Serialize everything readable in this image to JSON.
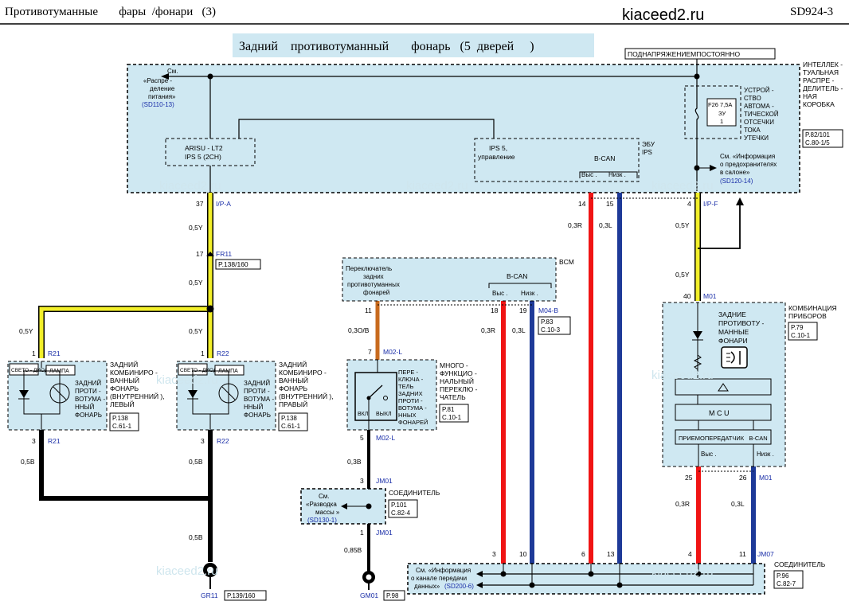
{
  "header": {
    "title_left": "Противотуманные       фары  /фонари   (3)",
    "site": "kiaceed2.ru",
    "code": "SD924-3"
  },
  "banner": {
    "title": "Задний    противотуманный       фонарь   (5  дверей     )"
  },
  "supply_label": "ПОДНАПРЯЖЕНИЕМПОСТОЯННО",
  "watermark": "kiaceed2.ru",
  "junction_box": {
    "label_lines": [
      "ИНТЕЛЛЕК -",
      "ТУАЛЬНАЯ",
      "РАСПРЕ -",
      "ДЕЛИТЕЛЬ -",
      "НАЯ",
      "КОРОБКА"
    ],
    "ref_lines": [
      "P.82/101",
      "C.80-1/5"
    ],
    "see_power_lines": [
      "См.",
      "«Распре  -",
      "деление",
      "питания»"
    ],
    "see_power_ref": "(SD110-13)",
    "arisu_lines": [
      "ARISU - LT2",
      "IPS 5 (2CH)"
    ],
    "ips_lines": [
      "IPS  5,",
      "управление"
    ],
    "bcan_label": "B-CAN",
    "bcan_high": "Выс .",
    "bcan_low": "Низк .",
    "ecu_lines": [
      "ЭБУ",
      "IPS"
    ],
    "fuse_lines": [
      "F26 7,5A",
      "ЗУ",
      "1"
    ],
    "rcd_lines": [
      "УСТРОЙ -",
      "СТВО",
      "АВТОМА -",
      "ТИЧЕСКОЙ",
      "ОТСЕЧКИ",
      "ТОКА",
      "УТЕЧКИ"
    ],
    "see_fuse_lines": [
      "См. «Информация",
      "о предохранителях",
      "в салоне»"
    ],
    "see_fuse_ref": "(SD120-14)"
  },
  "pins": {
    "p37": "37",
    "ipa": "I/P-A",
    "p17": "17",
    "fr11": "FR11",
    "fr11_ref": "P.138/160",
    "p14": "14",
    "p15": "15",
    "p4_top": "4",
    "ipf": "I/P-F",
    "p40": "40",
    "m01_top": "M01",
    "p1_left": "1",
    "r21_top": "R21",
    "p1_right": "1",
    "r22_top": "R22",
    "p3_left": "3",
    "r21_bot": "R21",
    "p3_right": "3",
    "r22_bot": "R22",
    "p11": "11",
    "p18": "18",
    "p19": "19",
    "m04b": "M04-B",
    "m04b_ref_lines": [
      "P.83",
      "C.10-3"
    ],
    "p7": "7",
    "m02l_top": "M02-L",
    "p5": "5",
    "m02l_bot": "M02-L",
    "p3_jm": "3",
    "jm01_top": "JM01",
    "p1_jm": "1",
    "jm01_bot": "JM01",
    "p25": "25",
    "p26": "26",
    "m01_bot": "M01",
    "b3": "3",
    "b10": "10",
    "b6": "6",
    "b13": "13",
    "b4": "4",
    "b11": "11",
    "jm07": "JM07"
  },
  "wires": {
    "y05_1": "0,5Y",
    "y05_2": "0,5Y",
    "y05_left": "0,5Y",
    "y05_right": "0,5Y",
    "r03_1": "0,3R",
    "l03_1": "0,3L",
    "y05_f1": "0,5Y",
    "y05_f2": "0,5Y",
    "o03b": "0,3O/B",
    "r03_2": "0,3R",
    "l03_2": "0,3L",
    "b05_left": "0,5B",
    "b05_right": "0,5B",
    "b03": "0,3B",
    "b05_bot": "0,5B",
    "b085": "0,85B",
    "r03_3": "0,3R",
    "l03_3": "0,3L"
  },
  "bcm": {
    "label": "BCM",
    "switch_lines": [
      "Переключатель",
      "задних",
      "противотуманных",
      "фонарей"
    ],
    "bcan_label": "B-CAN",
    "bcan_high": "Выс .",
    "bcan_low": "Низк ."
  },
  "cluster": {
    "label_lines": [
      "КОМБИНАЦИЯ",
      "ПРИБОРОВ"
    ],
    "ref_lines": [
      "P.79",
      "C.10-1"
    ],
    "lamp_lines": [
      "ЗАДНИЕ",
      "ПРОТИВОТУ -",
      "МАННЫЕ",
      "ФОНАРИ"
    ],
    "mcu": "M C U",
    "transceiver": "ПРИЕМОПЕРЕДАТЧИК   B-CAN",
    "high": "Выс .",
    "low": "Низк ."
  },
  "rear_left": {
    "led": "СВЕТО - ДИОД",
    "lamp": "ЛАМПА",
    "inner_lines": [
      "ЗАДНИЙ",
      "ПРОТИ -",
      "ВОТУМА -",
      "ННЫЙ",
      "ФОНАРЬ"
    ],
    "label_lines": [
      "ЗАДНИЙ",
      "КОМБИНИРО -",
      "ВАННЫЙ",
      "ФОНАРЬ",
      "(ВНУТРЕННИЙ ),",
      "ЛЕВЫЙ"
    ],
    "ref_lines": [
      "P.138",
      "C.61-1"
    ]
  },
  "rear_right": {
    "led": "СВЕТО - ДИОД",
    "lamp": "ЛАМПА",
    "inner_lines": [
      "ЗАДНИЙ",
      "ПРОТИ -",
      "ВОТУМА -",
      "ННЫЙ",
      "ФОНАРЬ"
    ],
    "label_lines": [
      "ЗАДНИЙ",
      "КОМБИНИРО -",
      "ВАННЫЙ",
      "ФОНАРЬ",
      "(ВНУТРЕННИЙ ),",
      "ПРАВЫЙ"
    ],
    "ref_lines": [
      "P.138",
      "C.61-1"
    ]
  },
  "multiswitch": {
    "inner_lines": [
      "ПЕРЕ -",
      "КЛЮЧА -",
      "ТЕЛЬ",
      "ЗАДНИХ",
      "ПРОТИ -",
      "ВОТУМА -",
      "ННЫХ",
      "ФОНАРЕЙ"
    ],
    "on": "ВКЛ",
    "off": "ВЫКЛ",
    "label_lines": [
      "МНОГО -",
      "ФУНКЦИО -",
      "НАЛЬНЫЙ",
      "ПЕРЕКЛЮ -",
      "ЧАТЕЛЬ"
    ],
    "ref_lines": [
      "P.81",
      "C.10-1"
    ]
  },
  "connector_jm01": {
    "see_lines": [
      "См.",
      "«Разводка",
      "массы      »"
    ],
    "see_ref": "(SD130-1)",
    "label": "СОЕДИНИТЕЛЬ",
    "ref_lines": [
      "P.101",
      "C.82-4"
    ]
  },
  "connector_bottom": {
    "see_lines": [
      "См. «Информация",
      "о канале   передачи",
      "данных»"
    ],
    "see_ref": "(SD200-6)",
    "label": "СОЕДИНИТЕЛЬ",
    "ref_lines": [
      "P.96",
      "C.82-7"
    ]
  },
  "grounds": {
    "gr11": "GR11",
    "gr11_ref": "P.139/160",
    "gm01": "GM01",
    "gm01_ref": "P.98"
  },
  "colors": {
    "box_fill": "#cfe8f2",
    "yellow": "#f2ef2a",
    "red": "#f01414",
    "blue": "#1e3a98",
    "orange": "#c86a1e",
    "pin_blue": "#1a2ea8"
  }
}
